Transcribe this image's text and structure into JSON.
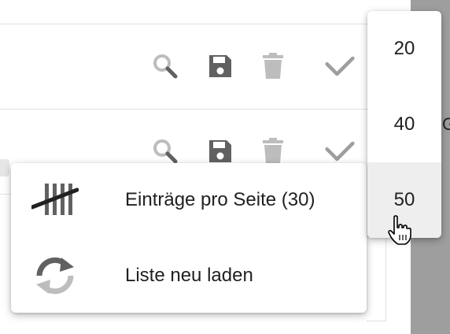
{
  "background_page": {
    "edge_text": "G",
    "rows": [
      {
        "actions": [
          {
            "name": "search-icon",
            "color": "#bdbdbd"
          },
          {
            "name": "save-icon",
            "color": "#616161"
          },
          {
            "name": "delete-icon",
            "color": "#bdbdbd"
          },
          {
            "name": "check-icon",
            "color": "#9e9e9e"
          }
        ]
      },
      {
        "actions": [
          {
            "name": "search-icon",
            "color": "#bdbdbd"
          },
          {
            "name": "save-icon",
            "color": "#616161"
          },
          {
            "name": "delete-icon",
            "color": "#bdbdbd"
          },
          {
            "name": "check-icon",
            "color": "#9e9e9e"
          }
        ]
      }
    ]
  },
  "context_menu": {
    "items": [
      {
        "icon": "tally-marks-icon",
        "label": "Einträge pro Seite (30)"
      },
      {
        "icon": "refresh-icon",
        "label": "Liste neu laden"
      }
    ]
  },
  "page_size_dropdown": {
    "options": [
      "20",
      "40",
      "50"
    ],
    "hovered": "50"
  },
  "colors": {
    "icon_dark": "#616161",
    "icon_light": "#bdbdbd",
    "hover_bg": "#eeeeee",
    "sidebar_gray": "#9e9e9e"
  }
}
